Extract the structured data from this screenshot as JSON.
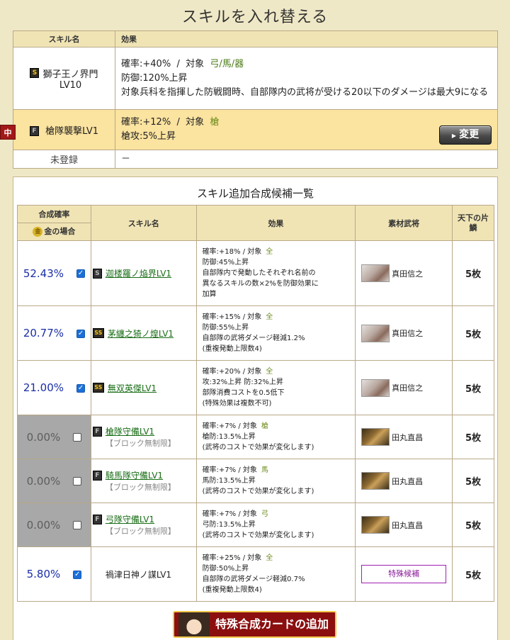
{
  "title": "スキルを入れ替える",
  "current_table": {
    "headers": {
      "skill": "スキル名",
      "effect": "効果"
    },
    "rows": [
      {
        "rank": "S",
        "name": "獅子王ノ界門",
        "level": "LV10",
        "rate_line": "確率:+40%",
        "sep": "/",
        "target_label": "対象",
        "target": "弓/馬/器",
        "effect1": "防御:120%上昇",
        "effect2": "対象兵科を指揮した防戦闘時、自部隊内の武将が受ける20以下のダメージは最大9になる"
      },
      {
        "marker": "中",
        "rank": "F",
        "name": "槍隊襲撃LV1",
        "rate_line": "確率:+12%",
        "sep": "/",
        "target_label": "対象",
        "target": "槍",
        "effect1": "槍攻:5%上昇",
        "change_button": "変更"
      },
      {
        "name": "未登録",
        "effect": "－"
      }
    ]
  },
  "candidates": {
    "title": "スキル追加合成候補一覧",
    "headers": {
      "rate": "合成確率",
      "gold_icon": "金",
      "gold_case": "金の場合",
      "skill": "スキル名",
      "effect": "効果",
      "general": "素材武将",
      "count": "天下の片鱗"
    },
    "rows": [
      {
        "rate": "52.43%",
        "checked": true,
        "enabled": true,
        "rank": "S",
        "name": "迦楼羅ノ焔界LV1",
        "link": true,
        "effects": [
          "確率:+18%  /  対象",
          "防御:45%上昇",
          "自部隊内で発動したそれぞれ名前の",
          "異なるスキルの数×2%を防御効果に",
          "加算"
        ],
        "target": "全",
        "general": "真田信之",
        "face": "a",
        "count": "5枚"
      },
      {
        "rate": "20.77%",
        "checked": true,
        "enabled": true,
        "rank": "SS",
        "name": "茅纏之猗ノ煌LV1",
        "link": true,
        "effects": [
          "確率:+15%  /  対象",
          "防御:55%上昇",
          "自部隊の武将ダメージ軽減1.2%",
          "(重複発動上限数4)"
        ],
        "target": "全",
        "general": "真田信之",
        "face": "a",
        "count": "5枚"
      },
      {
        "rate": "21.00%",
        "checked": true,
        "enabled": true,
        "rank": "SS",
        "name": "無双英傑LV1",
        "link": true,
        "effects": [
          "確率:+20%  /  対象",
          "攻:32%上昇  防:32%上昇",
          "部隊消費コストを0.5低下",
          "(特殊効果は複数不可)"
        ],
        "target": "全",
        "general": "真田信之",
        "face": "a",
        "count": "5枚"
      },
      {
        "rate": "0.00%",
        "checked": false,
        "enabled": false,
        "rank": "F",
        "name": "槍隊守備LV1",
        "link": true,
        "limit": "【ブロック無制限】",
        "effects": [
          "確率:+7%  /  対象",
          "槍防:13.5%上昇",
          "(武将のコストで効果が変化します)"
        ],
        "target": "槍",
        "general": "田丸直昌",
        "face": "b",
        "count": "5枚"
      },
      {
        "rate": "0.00%",
        "checked": false,
        "enabled": false,
        "rank": "F",
        "name": "騎馬隊守備LV1",
        "link": true,
        "limit": "【ブロック無制限】",
        "effects": [
          "確率:+7%  /  対象",
          "馬防:13.5%上昇",
          "(武将のコストで効果が変化します)"
        ],
        "target": "馬",
        "general": "田丸直昌",
        "face": "b",
        "count": "5枚"
      },
      {
        "rate": "0.00%",
        "checked": false,
        "enabled": false,
        "rank": "F",
        "name": "弓隊守備LV1",
        "link": true,
        "limit": "【ブロック無制限】",
        "effects": [
          "確率:+7%  /  対象",
          "弓防:13.5%上昇",
          "(武将のコストで効果が変化します)"
        ],
        "target": "弓",
        "general": "田丸直昌",
        "face": "b",
        "count": "5枚"
      },
      {
        "rate": "5.80%",
        "checked": true,
        "enabled": true,
        "rank": "",
        "name": "禍津日神ノ謀LV1",
        "link": false,
        "effects": [
          "確率:+25%  /  対象",
          "防御:50%上昇",
          "自部隊の武将ダメージ軽減0.7%",
          "(重複発動上限数4)"
        ],
        "target": "全",
        "special": "特殊候補",
        "count": "5枚"
      }
    ]
  },
  "special_button": "特殊合成カードの追加"
}
